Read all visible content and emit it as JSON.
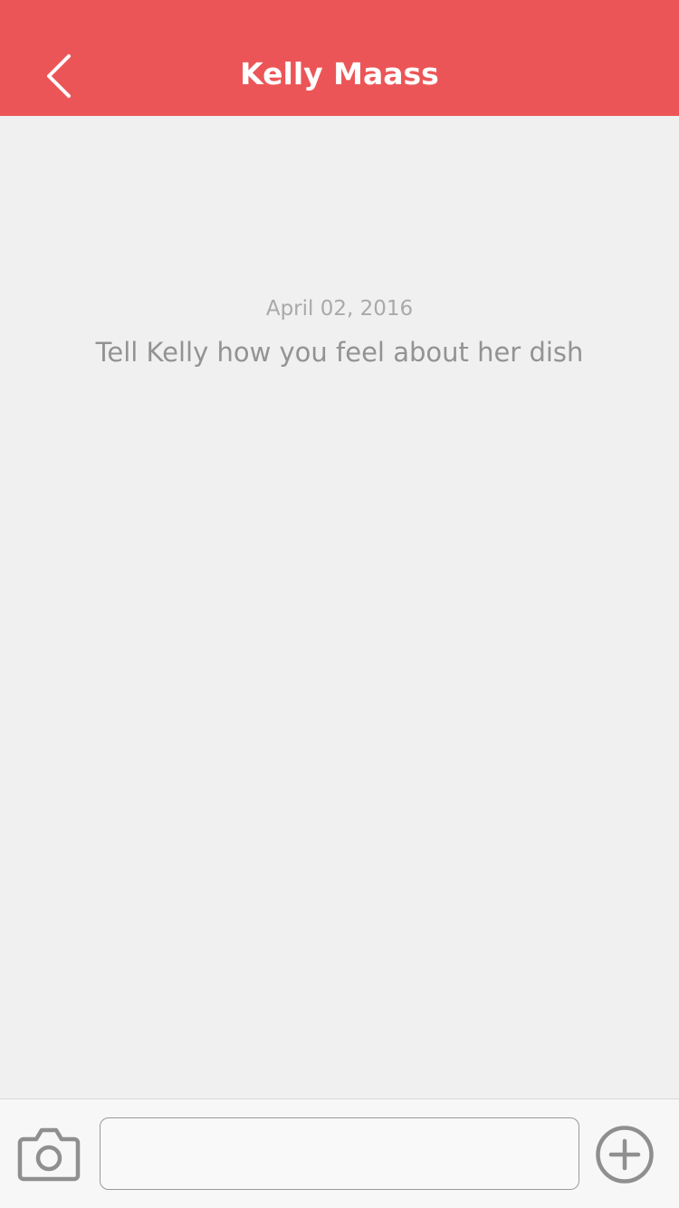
{
  "header": {
    "title": "Kelly Maass",
    "back_icon": "chevron-left-icon",
    "background_color": "#ec5557"
  },
  "conversation": {
    "date": "April 02, 2016",
    "prompt": "Tell Kelly how you feel about her dish"
  },
  "composer": {
    "camera_icon": "camera-icon",
    "input_value": "",
    "input_placeholder": "",
    "add_icon": "plus-circle-icon"
  }
}
